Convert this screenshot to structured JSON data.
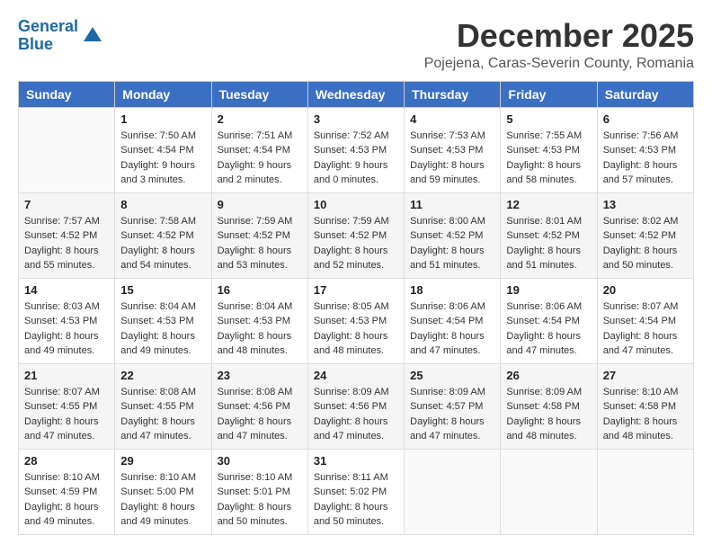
{
  "logo": {
    "text_general": "General",
    "text_blue": "Blue"
  },
  "title": "December 2025",
  "subtitle": "Pojejena, Caras-Severin County, Romania",
  "weekdays": [
    "Sunday",
    "Monday",
    "Tuesday",
    "Wednesday",
    "Thursday",
    "Friday",
    "Saturday"
  ],
  "weeks": [
    [
      {
        "day": "",
        "info": ""
      },
      {
        "day": "1",
        "info": "Sunrise: 7:50 AM\nSunset: 4:54 PM\nDaylight: 9 hours\nand 3 minutes."
      },
      {
        "day": "2",
        "info": "Sunrise: 7:51 AM\nSunset: 4:54 PM\nDaylight: 9 hours\nand 2 minutes."
      },
      {
        "day": "3",
        "info": "Sunrise: 7:52 AM\nSunset: 4:53 PM\nDaylight: 9 hours\nand 0 minutes."
      },
      {
        "day": "4",
        "info": "Sunrise: 7:53 AM\nSunset: 4:53 PM\nDaylight: 8 hours\nand 59 minutes."
      },
      {
        "day": "5",
        "info": "Sunrise: 7:55 AM\nSunset: 4:53 PM\nDaylight: 8 hours\nand 58 minutes."
      },
      {
        "day": "6",
        "info": "Sunrise: 7:56 AM\nSunset: 4:53 PM\nDaylight: 8 hours\nand 57 minutes."
      }
    ],
    [
      {
        "day": "7",
        "info": "Sunrise: 7:57 AM\nSunset: 4:52 PM\nDaylight: 8 hours\nand 55 minutes."
      },
      {
        "day": "8",
        "info": "Sunrise: 7:58 AM\nSunset: 4:52 PM\nDaylight: 8 hours\nand 54 minutes."
      },
      {
        "day": "9",
        "info": "Sunrise: 7:59 AM\nSunset: 4:52 PM\nDaylight: 8 hours\nand 53 minutes."
      },
      {
        "day": "10",
        "info": "Sunrise: 7:59 AM\nSunset: 4:52 PM\nDaylight: 8 hours\nand 52 minutes."
      },
      {
        "day": "11",
        "info": "Sunrise: 8:00 AM\nSunset: 4:52 PM\nDaylight: 8 hours\nand 51 minutes."
      },
      {
        "day": "12",
        "info": "Sunrise: 8:01 AM\nSunset: 4:52 PM\nDaylight: 8 hours\nand 51 minutes."
      },
      {
        "day": "13",
        "info": "Sunrise: 8:02 AM\nSunset: 4:52 PM\nDaylight: 8 hours\nand 50 minutes."
      }
    ],
    [
      {
        "day": "14",
        "info": "Sunrise: 8:03 AM\nSunset: 4:53 PM\nDaylight: 8 hours\nand 49 minutes."
      },
      {
        "day": "15",
        "info": "Sunrise: 8:04 AM\nSunset: 4:53 PM\nDaylight: 8 hours\nand 49 minutes."
      },
      {
        "day": "16",
        "info": "Sunrise: 8:04 AM\nSunset: 4:53 PM\nDaylight: 8 hours\nand 48 minutes."
      },
      {
        "day": "17",
        "info": "Sunrise: 8:05 AM\nSunset: 4:53 PM\nDaylight: 8 hours\nand 48 minutes."
      },
      {
        "day": "18",
        "info": "Sunrise: 8:06 AM\nSunset: 4:54 PM\nDaylight: 8 hours\nand 47 minutes."
      },
      {
        "day": "19",
        "info": "Sunrise: 8:06 AM\nSunset: 4:54 PM\nDaylight: 8 hours\nand 47 minutes."
      },
      {
        "day": "20",
        "info": "Sunrise: 8:07 AM\nSunset: 4:54 PM\nDaylight: 8 hours\nand 47 minutes."
      }
    ],
    [
      {
        "day": "21",
        "info": "Sunrise: 8:07 AM\nSunset: 4:55 PM\nDaylight: 8 hours\nand 47 minutes."
      },
      {
        "day": "22",
        "info": "Sunrise: 8:08 AM\nSunset: 4:55 PM\nDaylight: 8 hours\nand 47 minutes."
      },
      {
        "day": "23",
        "info": "Sunrise: 8:08 AM\nSunset: 4:56 PM\nDaylight: 8 hours\nand 47 minutes."
      },
      {
        "day": "24",
        "info": "Sunrise: 8:09 AM\nSunset: 4:56 PM\nDaylight: 8 hours\nand 47 minutes."
      },
      {
        "day": "25",
        "info": "Sunrise: 8:09 AM\nSunset: 4:57 PM\nDaylight: 8 hours\nand 47 minutes."
      },
      {
        "day": "26",
        "info": "Sunrise: 8:09 AM\nSunset: 4:58 PM\nDaylight: 8 hours\nand 48 minutes."
      },
      {
        "day": "27",
        "info": "Sunrise: 8:10 AM\nSunset: 4:58 PM\nDaylight: 8 hours\nand 48 minutes."
      }
    ],
    [
      {
        "day": "28",
        "info": "Sunrise: 8:10 AM\nSunset: 4:59 PM\nDaylight: 8 hours\nand 49 minutes."
      },
      {
        "day": "29",
        "info": "Sunrise: 8:10 AM\nSunset: 5:00 PM\nDaylight: 8 hours\nand 49 minutes."
      },
      {
        "day": "30",
        "info": "Sunrise: 8:10 AM\nSunset: 5:01 PM\nDaylight: 8 hours\nand 50 minutes."
      },
      {
        "day": "31",
        "info": "Sunrise: 8:11 AM\nSunset: 5:02 PM\nDaylight: 8 hours\nand 50 minutes."
      },
      {
        "day": "",
        "info": ""
      },
      {
        "day": "",
        "info": ""
      },
      {
        "day": "",
        "info": ""
      }
    ]
  ]
}
